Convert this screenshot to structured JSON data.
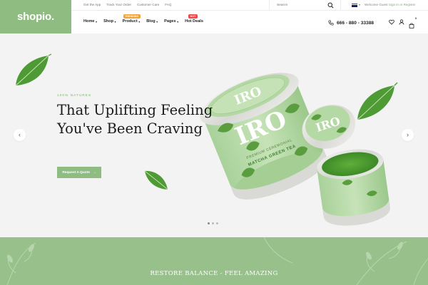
{
  "brand": {
    "logo_text": "shopio."
  },
  "topbar": {
    "links": [
      "Get the App",
      "Track Your Order",
      "Customer Care",
      "FAQ"
    ],
    "search_placeholder": "Search",
    "welcome_text": "Welcome Guest",
    "signin_label": "Sign in",
    "or_text": " or ",
    "register_label": "Register"
  },
  "nav": {
    "items": [
      {
        "label": "Home",
        "has_caret": true
      },
      {
        "label": "Shop",
        "has_caret": true
      },
      {
        "label": "Product",
        "has_caret": true,
        "badge": "TRENDING"
      },
      {
        "label": "Blog",
        "has_caret": true
      },
      {
        "label": "Pages",
        "has_caret": true
      },
      {
        "label": "Hot Deals",
        "has_caret": false,
        "badge": "HOT"
      }
    ],
    "phone": "666 - 880 - 33388",
    "cart_count": "0"
  },
  "hero": {
    "tagline": "100% NATURES",
    "title": "That Uplifting Feeling You've Been Craving",
    "button_label": "Request A Quote",
    "button_arrow": "→",
    "prev_label": "‹",
    "next_label": "›",
    "active_slide": 1,
    "slides_count": 3,
    "product": {
      "brand": "IRO",
      "subtitle": "PREMIUM CEREMONIAL",
      "name": "MATCHA GREEN TEA"
    }
  },
  "band": {
    "text": "RESTORE BALANCE - FEEL AMAZING"
  },
  "colors": {
    "accent": "#8fbc81",
    "accent_text": "#7eb36e",
    "band": "#98c08b",
    "badge_orange": "#f0a33b",
    "badge_red": "#e94a4a"
  }
}
